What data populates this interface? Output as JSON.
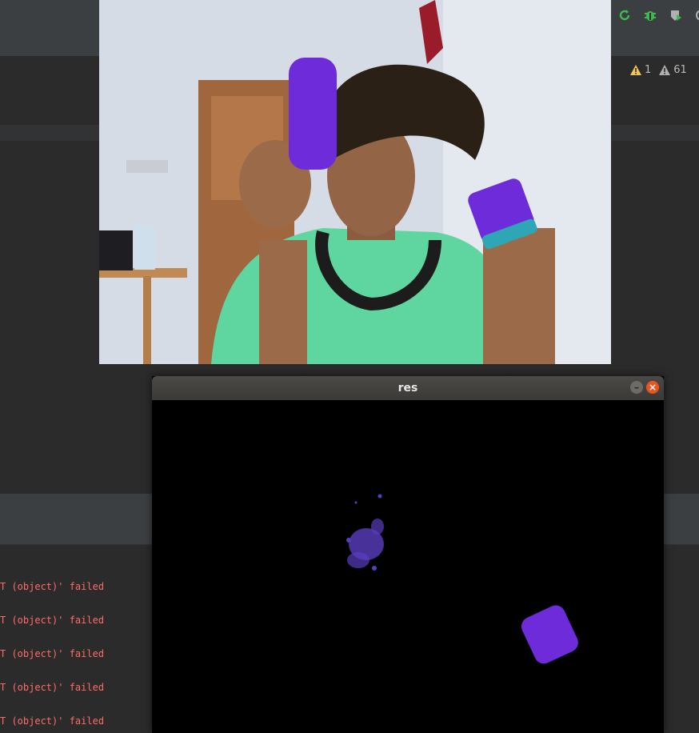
{
  "ide": {
    "toolbar_icons": [
      "rerun-icon",
      "debug-icon",
      "coverage-icon",
      "run-icon"
    ],
    "inspections": {
      "warnings": "1",
      "weak_warnings": "61"
    },
    "console_lines": [
      "T (object)' failed",
      "T (object)' failed",
      "T (object)' failed",
      "T (object)' failed",
      "T (object)' failed"
    ]
  },
  "res_window": {
    "title": "res",
    "minimize_label": "–",
    "close_label": "×"
  },
  "colors": {
    "console_error": "#ff6b68",
    "purple_object": "#6e2bd9",
    "teal_band": "#2ea6b5",
    "shirt_green": "#5fd6a0",
    "close_orange": "#e95420"
  }
}
